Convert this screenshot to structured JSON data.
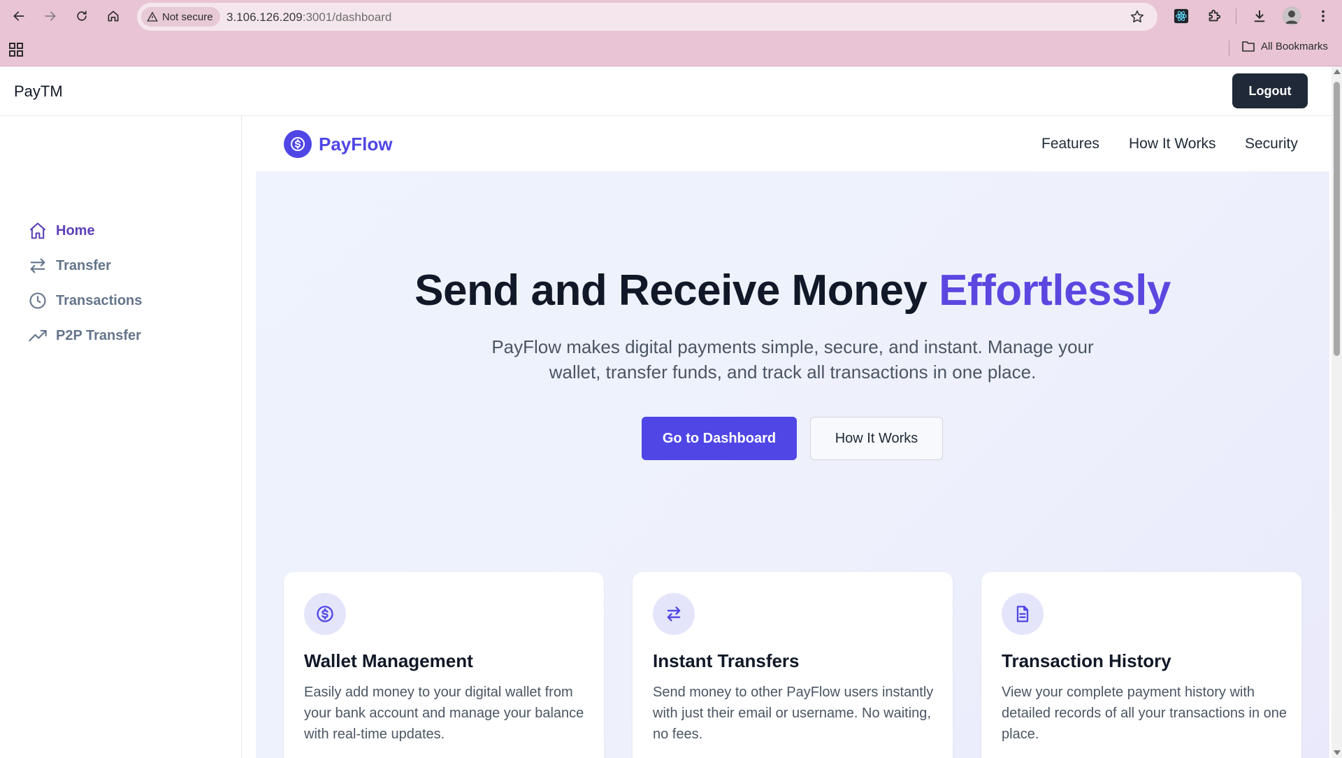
{
  "browser": {
    "security_label": "Not secure",
    "url_host": "3.106.126.209",
    "url_rest": ":3001/dashboard",
    "bookmarks_label": "All Bookmarks"
  },
  "app": {
    "brand": "PayTM",
    "logout_label": "Logout"
  },
  "sidebar": {
    "items": [
      {
        "label": "Home",
        "icon": "home-icon",
        "active": true
      },
      {
        "label": "Transfer",
        "icon": "transfer-arrows-icon",
        "active": false
      },
      {
        "label": "Transactions",
        "icon": "clock-icon",
        "active": false
      },
      {
        "label": "P2P Transfer",
        "icon": "trending-up-icon",
        "active": false
      }
    ]
  },
  "landing": {
    "logo_name": "PayFlow",
    "nav": [
      "Features",
      "How It Works",
      "Security"
    ],
    "hero": {
      "title_main": "Send and Receive Money ",
      "title_accent": "Effortlessly",
      "subtitle": "PayFlow makes digital payments simple, secure, and instant. Manage your wallet, transfer funds, and track all transactions in one place.",
      "primary_cta": "Go to Dashboard",
      "secondary_cta": "How It Works"
    },
    "features": [
      {
        "title": "Wallet Management",
        "icon": "dollar-coin-icon",
        "description": "Easily add money to your digital wallet from your bank account and manage your balance with real-time updates."
      },
      {
        "title": "Instant Transfers",
        "icon": "transfer-arrows-icon",
        "description": "Send money to other PayFlow users instantly with just their email or username. No waiting, no fees."
      },
      {
        "title": "Transaction History",
        "icon": "document-icon",
        "description": "View your complete payment history with detailed records of all your transactions in one place."
      }
    ]
  },
  "colors": {
    "accent": "#4f46e5",
    "sidebar_active": "#5b3fb8",
    "logout_bg": "#1f2937",
    "chrome_bg": "#e8c4d4"
  }
}
